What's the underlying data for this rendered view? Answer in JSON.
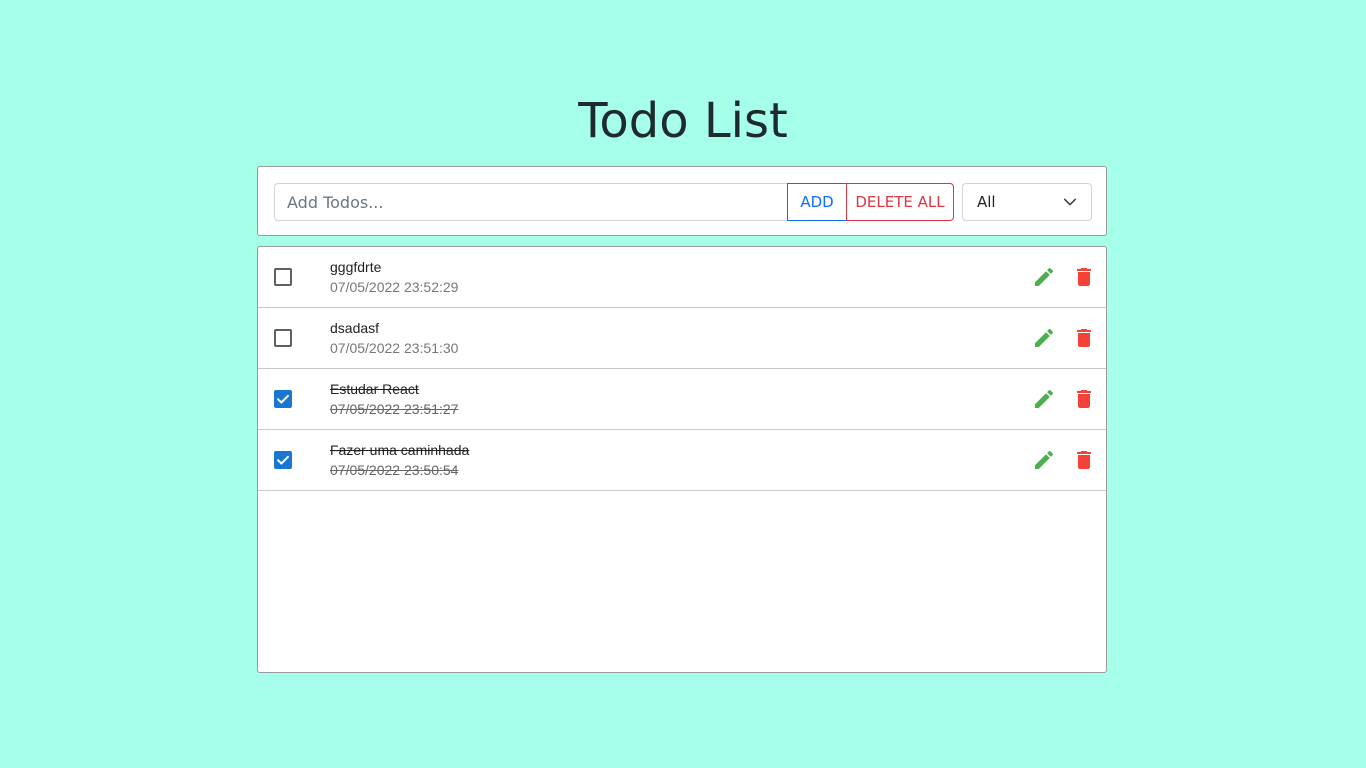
{
  "header": {
    "title": "Todo List"
  },
  "toolbar": {
    "input_placeholder": "Add Todos...",
    "input_value": "",
    "add_label": "ADD",
    "delete_all_label": "DELETE ALL",
    "filter_value": "All"
  },
  "todos": [
    {
      "text": "gggfdrte",
      "timestamp": "07/05/2022 23:52:29",
      "completed": false
    },
    {
      "text": "dsadasf",
      "timestamp": "07/05/2022 23:51:30",
      "completed": false
    },
    {
      "text": "Estudar React",
      "timestamp": "07/05/2022 23:51:27",
      "completed": true
    },
    {
      "text": "Fazer uma caminhada",
      "timestamp": "07/05/2022 23:50:54",
      "completed": true
    }
  ],
  "icons": {
    "edit": "pencil-icon",
    "delete": "trash-icon",
    "filter_toggle": "chevron-down-icon",
    "checked": "checkmark-icon"
  },
  "colors": {
    "background": "#a5ffe9",
    "add_button": "#0d6efd",
    "delete_all_button": "#dc3545",
    "edit_icon": "#4caf50",
    "delete_icon": "#f44336",
    "checkbox_checked": "#1976d2"
  }
}
